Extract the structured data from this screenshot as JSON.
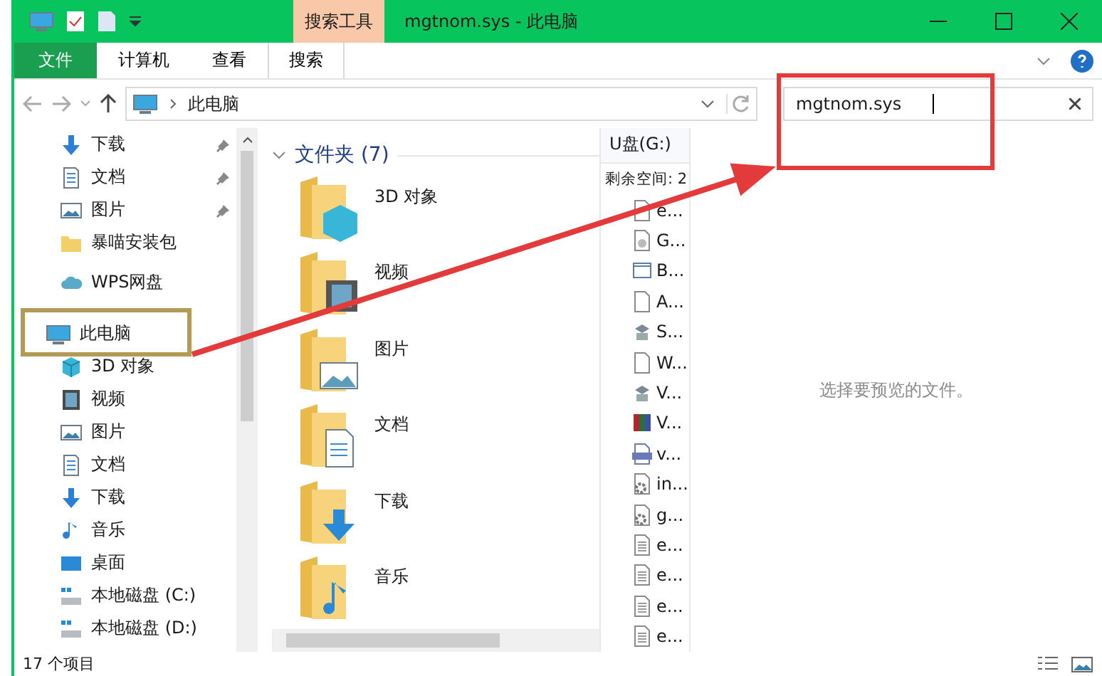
{
  "title_bar": {
    "context_tab": "搜索工具",
    "title": "mgtnom.sys - 此电脑"
  },
  "ribbon_tabs": [
    {
      "label": "文件",
      "kind": "file",
      "selected": false
    },
    {
      "label": "计算机",
      "kind": "tab",
      "selected": false
    },
    {
      "label": "查看",
      "kind": "tab",
      "selected": false
    },
    {
      "label": "搜索",
      "kind": "tab",
      "selected": true
    }
  ],
  "address_bar": {
    "path": "此电脑"
  },
  "search": {
    "value": "mgtnom.sys"
  },
  "nav_pane": {
    "items": [
      {
        "label": "下载",
        "kind": "download",
        "pinned": true
      },
      {
        "label": "文档",
        "kind": "document",
        "pinned": true
      },
      {
        "label": "图片",
        "kind": "picture",
        "pinned": true
      },
      {
        "label": "暴喵安装包",
        "kind": "folder",
        "pinned": false
      },
      {
        "label": "WPS网盘",
        "kind": "cloud",
        "pinned": false
      },
      {
        "label": "此电脑",
        "kind": "pc",
        "pinned": false,
        "children": [
          {
            "label": "3D 对象",
            "kind": "cube"
          },
          {
            "label": "视频",
            "kind": "video"
          },
          {
            "label": "图片",
            "kind": "picture"
          },
          {
            "label": "文档",
            "kind": "document"
          },
          {
            "label": "下载",
            "kind": "download"
          },
          {
            "label": "音乐",
            "kind": "music"
          },
          {
            "label": "桌面",
            "kind": "desktop"
          },
          {
            "label": "本地磁盘 (C:)",
            "kind": "drive"
          },
          {
            "label": "本地磁盘 (D:)",
            "kind": "drive"
          }
        ]
      }
    ]
  },
  "folders": {
    "heading": "文件夹 (7)",
    "expanded": true,
    "items": [
      {
        "label": "3D 对象",
        "kind": "cube"
      },
      {
        "label": "视频",
        "kind": "video"
      },
      {
        "label": "图片",
        "kind": "picture"
      },
      {
        "label": "文档",
        "kind": "document"
      },
      {
        "label": "下载",
        "kind": "download"
      },
      {
        "label": "音乐",
        "kind": "music"
      }
    ]
  },
  "drive_pane": {
    "title": "U盘(G:)",
    "free_space": "剩余空间: 2",
    "files": [
      {
        "name": "e...",
        "kind": "blank"
      },
      {
        "name": "G...",
        "kind": "disc"
      },
      {
        "name": "B...",
        "kind": "window"
      },
      {
        "name": "A...",
        "kind": "blank"
      },
      {
        "name": "S...",
        "kind": "setup"
      },
      {
        "name": "W...",
        "kind": "blank"
      },
      {
        "name": "V...",
        "kind": "setup"
      },
      {
        "name": "V...",
        "kind": "archive"
      },
      {
        "name": "v...",
        "kind": "bmp"
      },
      {
        "name": "in...",
        "kind": "gear"
      },
      {
        "name": "g...",
        "kind": "gear"
      },
      {
        "name": "e...",
        "kind": "text"
      },
      {
        "name": "e...",
        "kind": "text"
      },
      {
        "name": "e...",
        "kind": "text"
      },
      {
        "name": "e...",
        "kind": "text"
      }
    ]
  },
  "preview": {
    "message": "选择要预览的文件。"
  },
  "status_bar": {
    "count": "17 个项目"
  }
}
